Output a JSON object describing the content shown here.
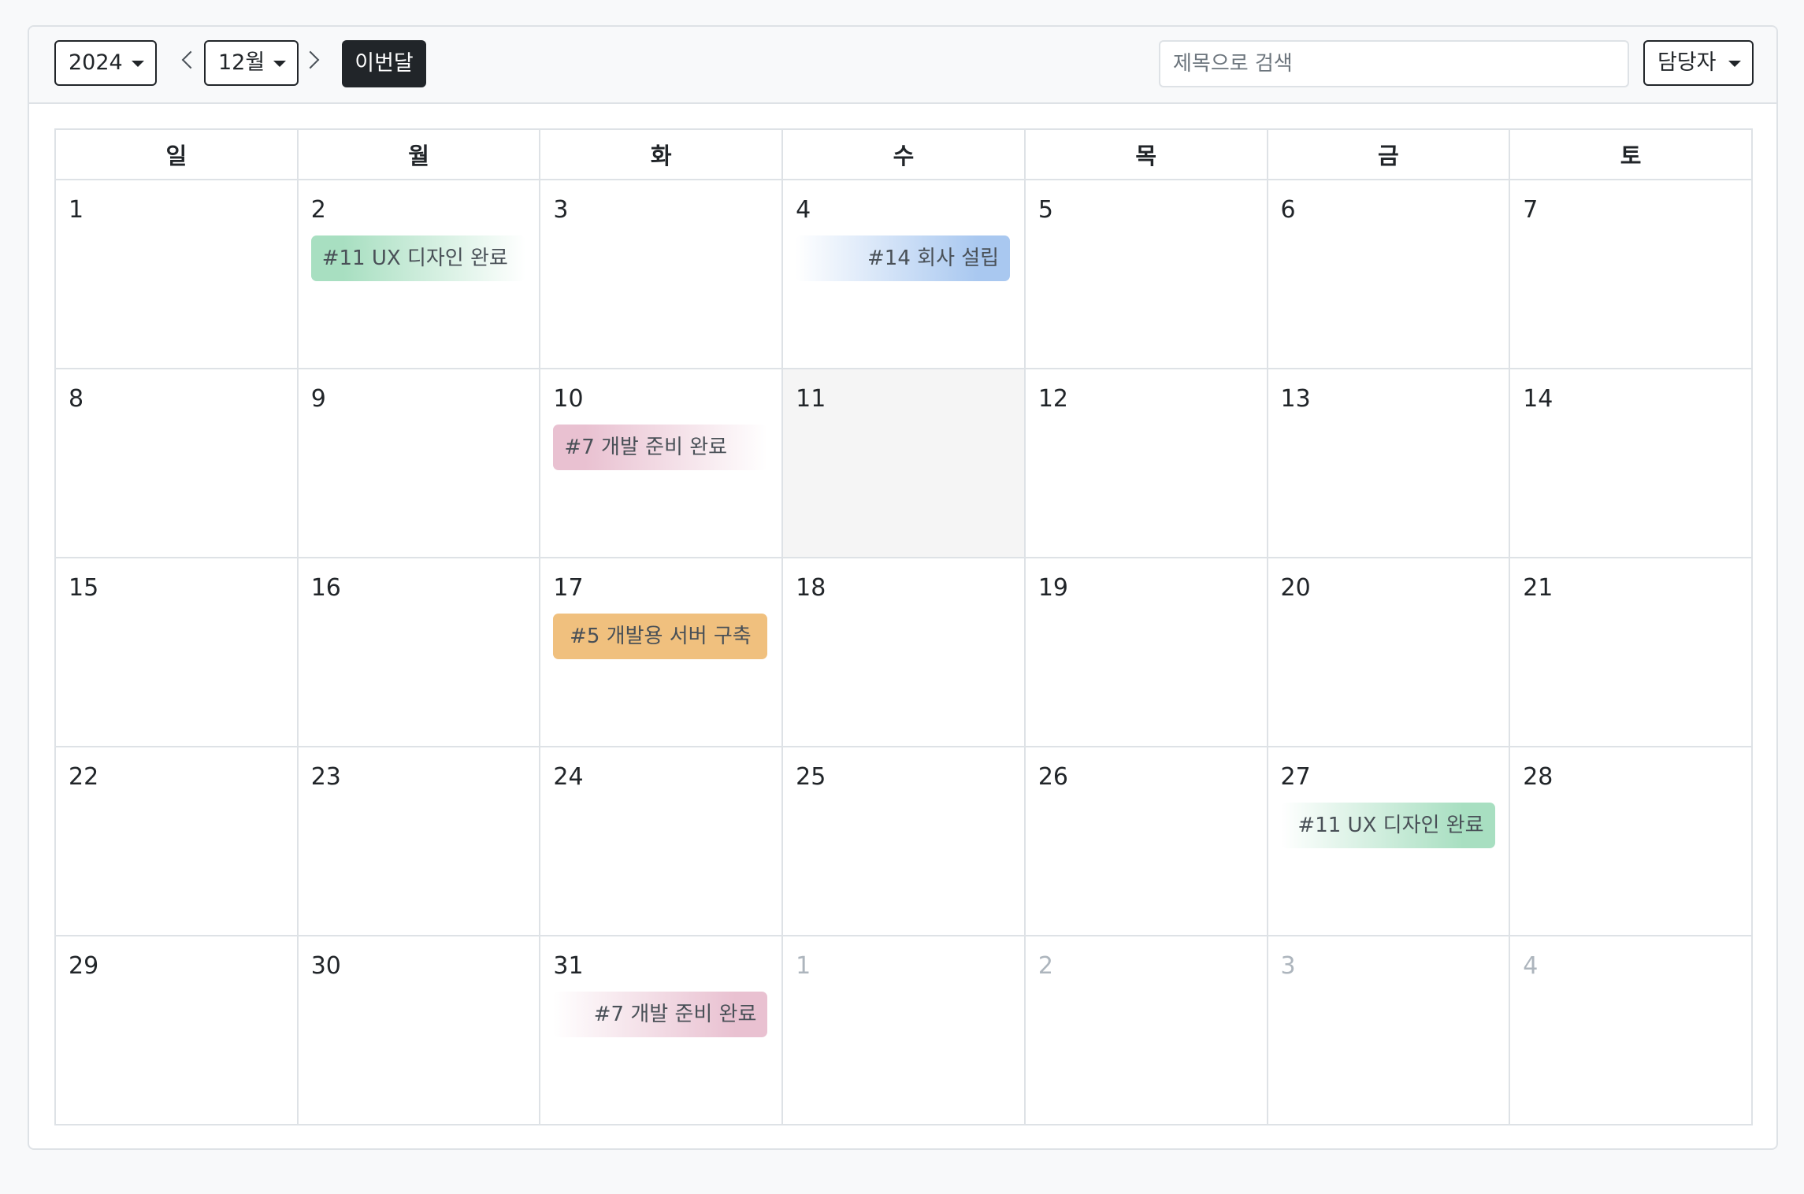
{
  "toolbar": {
    "year": "2024",
    "month": "12월",
    "today_label": "이번달",
    "search_placeholder": "제목으로 검색",
    "assignee_label": "담당자"
  },
  "weekdays": [
    "일",
    "월",
    "화",
    "수",
    "목",
    "금",
    "토"
  ],
  "weeks": [
    [
      {
        "day": "1"
      },
      {
        "day": "2",
        "event": {
          "label": "#11 UX 디자인 완료",
          "color": "#a8dfc1",
          "style": "start"
        }
      },
      {
        "day": "3"
      },
      {
        "day": "4",
        "event": {
          "label": "#14 회사 설립",
          "color": "#a9c8f0",
          "style": "end"
        }
      },
      {
        "day": "5"
      },
      {
        "day": "6"
      },
      {
        "day": "7"
      }
    ],
    [
      {
        "day": "8"
      },
      {
        "day": "9"
      },
      {
        "day": "10",
        "event": {
          "label": "#7 개발 준비 완료",
          "color": "#e9c1d1",
          "style": "start"
        }
      },
      {
        "day": "11",
        "today": true
      },
      {
        "day": "12"
      },
      {
        "day": "13"
      },
      {
        "day": "14"
      }
    ],
    [
      {
        "day": "15"
      },
      {
        "day": "16"
      },
      {
        "day": "17",
        "event": {
          "label": "#5 개발용 서버 구축",
          "color": "#f0c07e",
          "style": "full"
        }
      },
      {
        "day": "18"
      },
      {
        "day": "19"
      },
      {
        "day": "20"
      },
      {
        "day": "21"
      }
    ],
    [
      {
        "day": "22"
      },
      {
        "day": "23"
      },
      {
        "day": "24"
      },
      {
        "day": "25"
      },
      {
        "day": "26"
      },
      {
        "day": "27",
        "event": {
          "label": "#11 UX 디자인 완료",
          "color": "#a8dfc1",
          "style": "end"
        }
      },
      {
        "day": "28"
      }
    ],
    [
      {
        "day": "29"
      },
      {
        "day": "30"
      },
      {
        "day": "31",
        "event": {
          "label": "#7 개발 준비 완료",
          "color": "#e9c1d1",
          "style": "end"
        }
      },
      {
        "day": "1",
        "other": true
      },
      {
        "day": "2",
        "other": true
      },
      {
        "day": "3",
        "other": true
      },
      {
        "day": "4",
        "other": true
      }
    ]
  ]
}
